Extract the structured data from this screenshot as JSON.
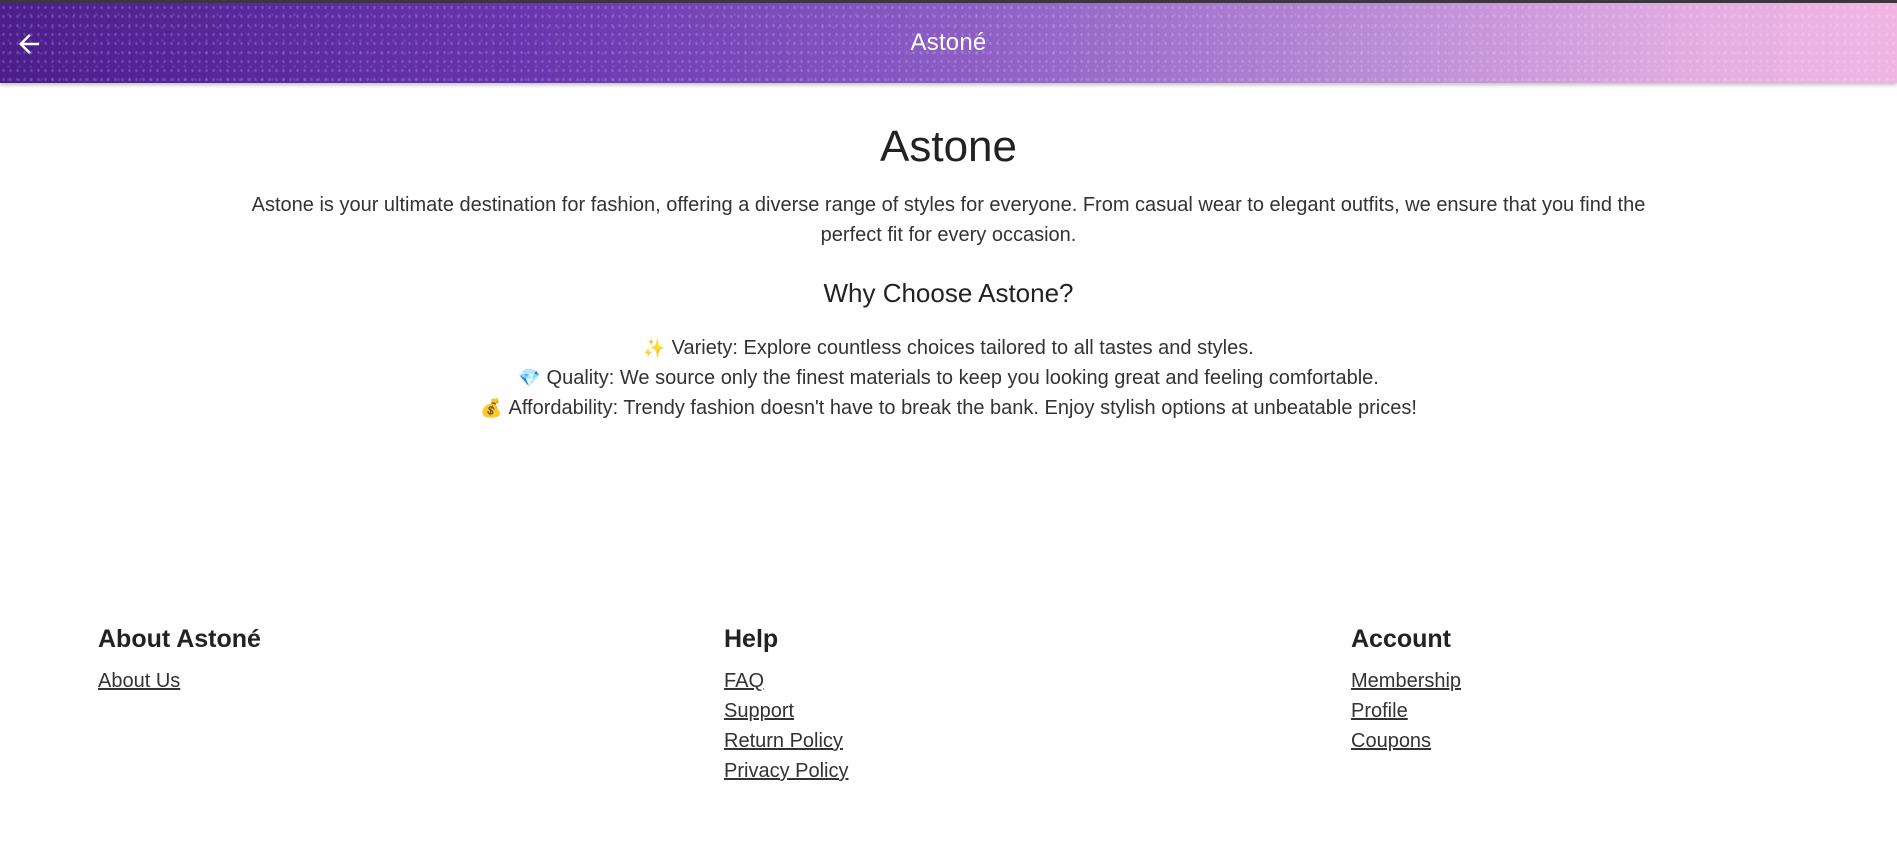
{
  "header": {
    "title": "Astoné",
    "back_icon": "arrow-left-icon",
    "gradient_colors": [
      "#4b1e8c",
      "#6a35b0",
      "#b98ad6",
      "#f1b5e3"
    ]
  },
  "main": {
    "title": "Astone",
    "intro": "Astone is your ultimate destination for fashion, offering a diverse range of styles for everyone. From casual wear to elegant outfits, we ensure that you find the perfect fit for every occasion.",
    "why_title": "Why Choose Astone?",
    "features": [
      {
        "emoji": "✨",
        "icon": "sparkles-icon",
        "text": "Variety: Explore countless choices tailored to all tastes and styles."
      },
      {
        "emoji": "💎",
        "icon": "gem-icon",
        "text": "Quality: We source only the finest materials to keep you looking great and feeling comfortable."
      },
      {
        "emoji": "💰",
        "icon": "money-bag-icon",
        "text": "Affordability: Trendy fashion doesn't have to break the bank. Enjoy stylish options at unbeatable prices!"
      }
    ]
  },
  "footer": {
    "about": {
      "heading": "About Astoné",
      "links": [
        "About Us"
      ]
    },
    "help": {
      "heading": "Help",
      "links": [
        "FAQ",
        "Support",
        "Return Policy",
        "Privacy Policy"
      ]
    },
    "account": {
      "heading": "Account",
      "links": [
        "Membership",
        "Profile",
        "Coupons"
      ]
    }
  }
}
